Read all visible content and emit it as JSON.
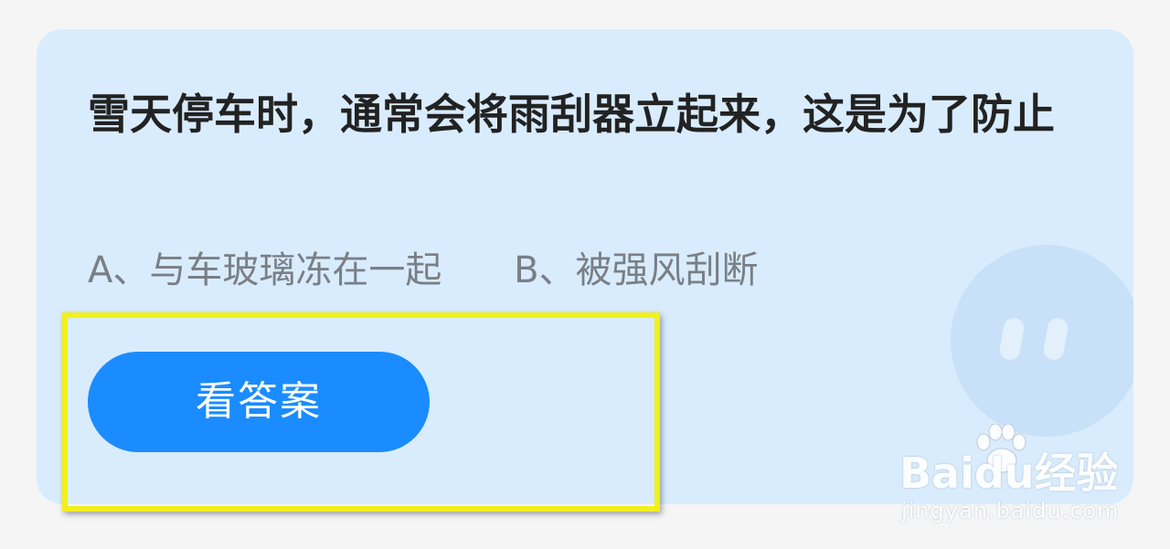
{
  "question": {
    "text": "雪天停车时，通常会将雨刮器立起来，这是为了防止"
  },
  "options": [
    {
      "label": "A、与车玻璃冻在一起"
    },
    {
      "label": "B、被强风刮断"
    }
  ],
  "answer_button": {
    "label": "看答案"
  },
  "watermark": {
    "logo": "Baidu经验",
    "url": "jingyan.baidu.com"
  },
  "colors": {
    "page_background": "#f5f5f5",
    "card_background": "#d9ecfd",
    "button": "#1a8cff",
    "highlight": "#f2f01c"
  }
}
